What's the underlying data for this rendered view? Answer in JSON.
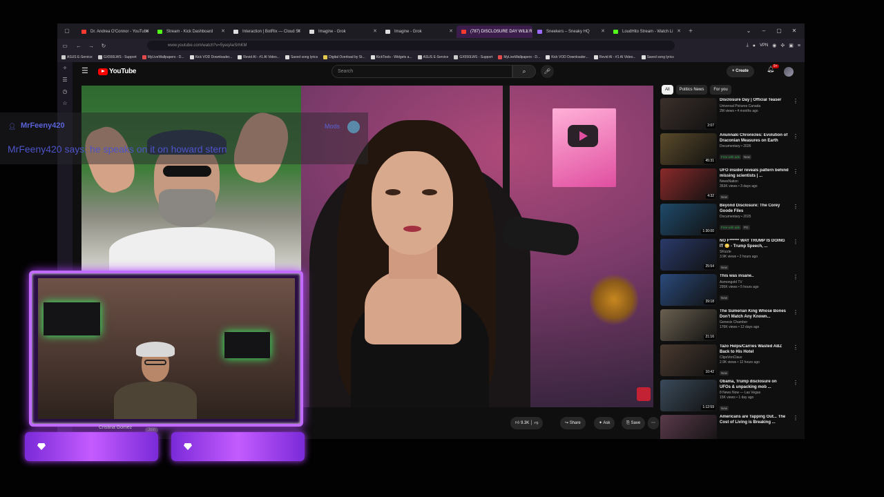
{
  "browser": {
    "tabs": [
      {
        "label": "Dr. Andrea O'Connor - YouTube",
        "color": "#ff3b30"
      },
      {
        "label": "Stream - Kick Dashboard",
        "color": "#53fc18"
      },
      {
        "label": "Interaction | BotRix — Cloud St",
        "color": "#dddddd"
      },
      {
        "label": "Imagine - Grok",
        "color": "#dddddd"
      },
      {
        "label": "Imagine - Grok",
        "color": "#dddddd"
      },
      {
        "label": "(787) DISCLOSURE DAY WILL R",
        "color": "#ff3b30",
        "active": true
      },
      {
        "label": "Sneekers – Sneaky HQ",
        "color": "#9d6bff"
      },
      {
        "label": "LoudHito Stream - Watch Li",
        "color": "#53fc18"
      }
    ],
    "url": "www.youtube.com/watch?v=5yeqAeSrhKM",
    "vpn_label": "VPN",
    "bookmarks": [
      {
        "label": "ASUS E-Service",
        "color": "#cccccc"
      },
      {
        "label": "GX550LWS - Support",
        "color": "#cccccc"
      },
      {
        "label": "MyLiveWallpapers - D...",
        "color": "#e24b4b"
      },
      {
        "label": "Kick VOD Downloader...",
        "color": "#dddddd"
      },
      {
        "label": "Revid AI - #1 AI Video...",
        "color": "#dddddd"
      },
      {
        "label": "Saved song lyrics",
        "color": "#dddddd"
      },
      {
        "label": "Digital Overload by St...",
        "color": "#e2c94b"
      },
      {
        "label": "KickTools - Widgets a...",
        "color": "#dddddd"
      },
      {
        "label": "ASUS E-Service",
        "color": "#cccccc"
      },
      {
        "label": "GX550LWS - Support",
        "color": "#cccccc"
      },
      {
        "label": "MyLiveWallpapers - D...",
        "color": "#e24b4b"
      },
      {
        "label": "Kick VOD Downloader...",
        "color": "#dddddd"
      },
      {
        "label": "Revid AI - #1 AI Video...",
        "color": "#dddddd"
      },
      {
        "label": "Saved song lyrics",
        "color": "#dddddd"
      }
    ]
  },
  "youtube": {
    "logo_text": "YouTube",
    "search_placeholder": "Search",
    "create_label": "Create",
    "notif_count": "9+",
    "actions": {
      "likes": "9.3K",
      "share": "Share",
      "ask": "Ask",
      "save": "Save"
    },
    "chips": [
      "All",
      "Politics News",
      "For you"
    ],
    "recommendations": [
      {
        "title": "Disclosure Day | Official Teaser",
        "channel": "Universal Pictures Canada",
        "meta": "2M views • 4 months ago",
        "duration": "2:07",
        "badges": [],
        "thumb": "#3b2f2a"
      },
      {
        "title": "Anunnaki Chronicles: Evolution of Draconian Measures on Earth",
        "channel": "Documentary • 2026",
        "meta": "",
        "duration": "45:31",
        "badges": [
          "Free with ads",
          "New"
        ],
        "thumb": "#5a4a2a"
      },
      {
        "title": "UFO insider reveals pattern behind missing scientists | ...",
        "channel": "NewsNation",
        "meta": "353K views • 3 days ago",
        "duration": "4:32",
        "badges": [
          "New"
        ],
        "thumb": "#8a2a2a"
      },
      {
        "title": "Beyond Disclosure: The Corey Goode Files",
        "channel": "Documentary • 2025",
        "meta": "",
        "duration": "1:30:00",
        "badges": [
          "Free with ads",
          "PG"
        ],
        "thumb": "#1f4a6a"
      },
      {
        "title": "NO F****** WAY TRUMP IS DOING IT 😳 - Trump Speech, ...",
        "channel": "SKizzle",
        "meta": "3.9K views • 2 hours ago",
        "duration": "25:54",
        "badges": [
          "New"
        ],
        "thumb": "#2a3a6a"
      },
      {
        "title": "This was insane..",
        "channel": "Asmongold TV",
        "meta": "295K views • 5 hours ago",
        "duration": "39:18",
        "badges": [
          "New"
        ],
        "thumb": "#2a4a7a"
      },
      {
        "title": "The Sumerian King Whose Bones Don't Match Any Known...",
        "channel": "Genesis Chamber",
        "meta": "176K views • 12 days ago",
        "duration": "21:16",
        "badges": [],
        "thumb": "#6a6050"
      },
      {
        "title": "Tazo Helps/Carries Wasted ABZ Back to His Hotel",
        "channel": "ClipsVonClaus",
        "meta": "2.9K views • 12 hours ago",
        "duration": "10:42",
        "badges": [
          "New"
        ],
        "thumb": "#4a3a30"
      },
      {
        "title": "Obama, Trump disclosure on UFOs & unpacking mob ...",
        "channel": "8 News Now — Las Vegas",
        "meta": "15K views • 1 day ago",
        "duration": "1:12:59",
        "badges": [
          "New"
        ],
        "thumb": "#3a4a5a"
      },
      {
        "title": "Americans are Tapping Out... The Cost of Living is Breaking ...",
        "channel": "",
        "meta": "",
        "duration": "",
        "badges": [],
        "thumb": "#5a3a4a"
      }
    ]
  },
  "overlay": {
    "chat_username": "MrFeeny420",
    "chat_mod_label": "Mods",
    "chat_message": "MrFeeny420 says: he speaks on it on howard stern",
    "channel_name": "Cristina Gomez",
    "join_label": "Join"
  }
}
